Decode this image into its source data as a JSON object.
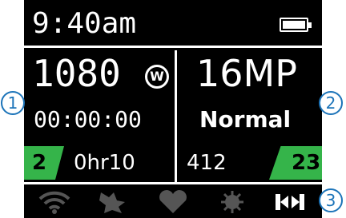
{
  "status": {
    "time": "9:40am",
    "battery_icon": "battery-icon"
  },
  "video": {
    "resolution": "1080",
    "mode_badge": "W",
    "duration": "00:00:00",
    "clip_count": "2",
    "remaining": "0hr10"
  },
  "photo": {
    "resolution": "16MP",
    "mode": "Normal",
    "remaining_count": "412",
    "photo_count": "23"
  },
  "toolbar": {
    "icons": [
      "wifi-icon",
      "ant-sensor-icon",
      "heart-rate-icon",
      "settings-icon",
      "video-loop-icon"
    ]
  },
  "callouts": [
    "1",
    "2",
    "3"
  ],
  "colors": {
    "screen_bg": "#000000",
    "accent_green": "#35b44a",
    "icon_dim": "#555555",
    "callout_blue": "#1c74b9"
  }
}
